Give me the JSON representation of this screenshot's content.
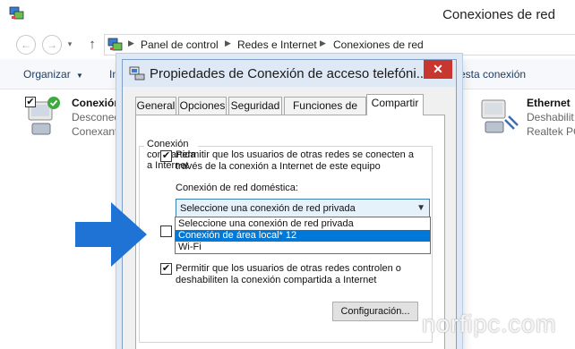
{
  "explorer": {
    "window_title": "Conexiones de red",
    "breadcrumb": [
      "Panel de control",
      "Redes e Internet",
      "Conexiones de red"
    ],
    "commands": {
      "organize": "Organizar",
      "organize_arrow": "▼",
      "partial_left": "Ini",
      "partial_right": "ar esta conexión"
    },
    "connections": [
      {
        "name": "Conexión",
        "status": "Desconect",
        "device": "Conexant U"
      },
      {
        "name": "Ethernet",
        "status": "Deshabilit",
        "device": "Realtek PC"
      }
    ]
  },
  "dialog": {
    "title": "Propiedades de Conexión de acceso telefóni...",
    "close_label": "✕",
    "tabs": [
      {
        "label": "General"
      },
      {
        "label": "Opciones"
      },
      {
        "label": "Seguridad"
      },
      {
        "label": "Funciones de red"
      },
      {
        "label": "Compartir",
        "active": true
      }
    ],
    "group_title": "Conexión compartida a Internet",
    "allow_connect": {
      "checked": true,
      "line1": "Permitir que los usuarios de otras redes se conecten a",
      "line2": "través de la conexión a Internet de este equipo"
    },
    "home_network_label": "Conexión de red doméstica:",
    "combo_value": "Seleccione una conexión de red privada",
    "combo_options": [
      "Seleccione una conexión de red privada",
      "Conexión de área local* 12",
      "Wi-Fi"
    ],
    "combo_selected_index": 1,
    "dial_on_demand": {
      "checked": false
    },
    "allow_control": {
      "checked": true,
      "line1": "Permitir que los usuarios de otras redes controlen o",
      "line2": "deshabiliten la conexión compartida a Internet"
    },
    "settings_button": "Configuración...",
    "check_glyph": "✔"
  },
  "watermark": "norfipc.com",
  "colors": {
    "accent_blue": "#0078d7",
    "arrow_blue": "#1e73d4",
    "close_red": "#c7372f",
    "dialog_frame": "#dfe9f5"
  }
}
